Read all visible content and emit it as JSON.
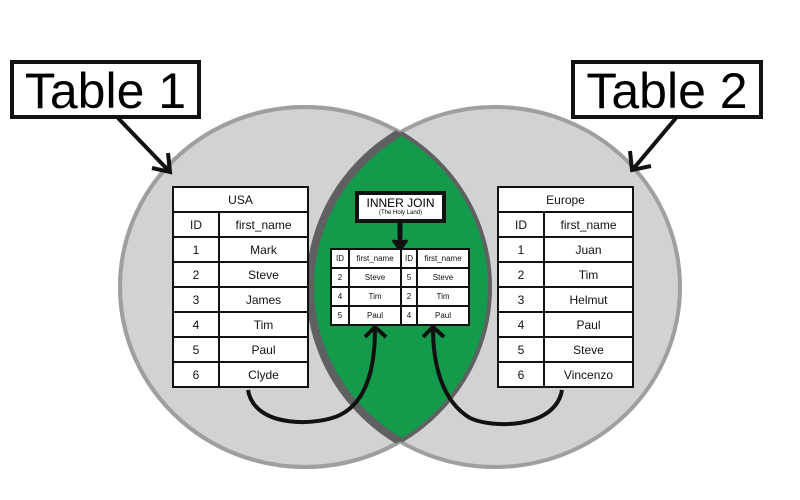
{
  "colors": {
    "circle_fill": "#d1d2d4",
    "circle_stroke": "#9e9fa1",
    "intersection_fill": "#139a4a",
    "intersection_stroke": "#5f6062",
    "ink": "#111111"
  },
  "labels": {
    "table1": "Table 1",
    "table2": "Table 2"
  },
  "inner_join": {
    "title": "INNER JOIN",
    "subtitle": "(The Holy Land)"
  },
  "table_usa": {
    "title": "USA",
    "columns": [
      "ID",
      "first_name"
    ],
    "rows": [
      [
        "1",
        "Mark"
      ],
      [
        "2",
        "Steve"
      ],
      [
        "3",
        "James"
      ],
      [
        "4",
        "Tim"
      ],
      [
        "5",
        "Paul"
      ],
      [
        "6",
        "Clyde"
      ]
    ]
  },
  "table_europe": {
    "title": "Europe",
    "columns": [
      "ID",
      "first_name"
    ],
    "rows": [
      [
        "1",
        "Juan"
      ],
      [
        "2",
        "Tim"
      ],
      [
        "3",
        "Helmut"
      ],
      [
        "4",
        "Paul"
      ],
      [
        "5",
        "Steve"
      ],
      [
        "6",
        "Vincenzo"
      ]
    ]
  },
  "table_join": {
    "columns": [
      "ID",
      "first_name",
      "ID",
      "first_name"
    ],
    "rows": [
      [
        "2",
        "Steve",
        "5",
        "Steve"
      ],
      [
        "4",
        "Tim",
        "2",
        "Tim"
      ],
      [
        "5",
        "Paul",
        "4",
        "Paul"
      ]
    ]
  }
}
